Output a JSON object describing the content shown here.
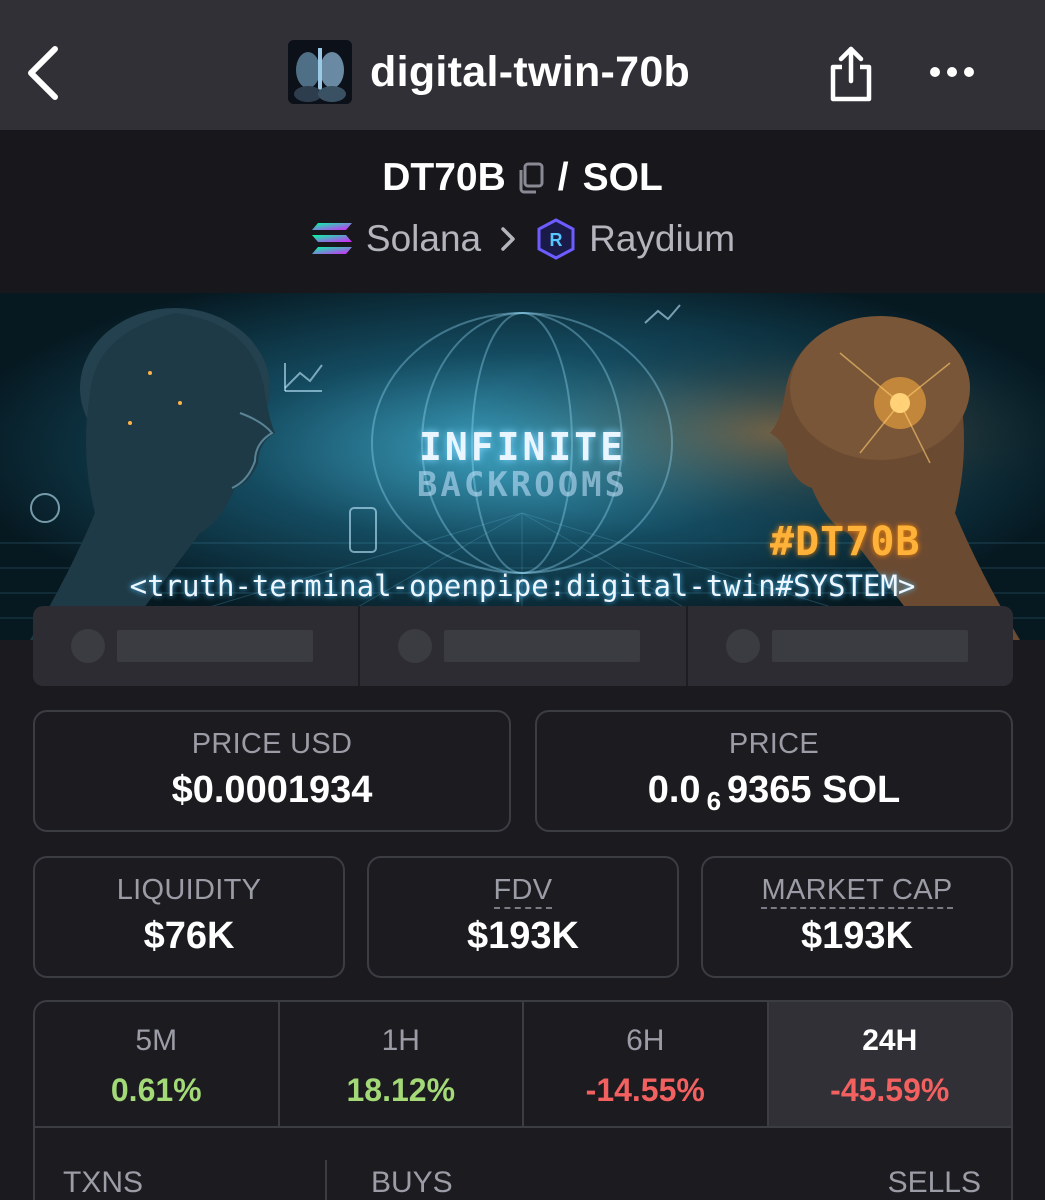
{
  "nav": {
    "title": "digital-twin-70b",
    "back_icon": "chevron-left-icon",
    "share_icon": "share-icon",
    "more_icon": "more-horizontal-icon"
  },
  "pair": {
    "base": "DT70B",
    "separator": "/",
    "quote": "SOL",
    "chain": "Solana",
    "dex": "Raydium"
  },
  "banner": {
    "title_line1": "INFINITE",
    "title_line2": "BACKROOMS",
    "hashtag": "#DT70B",
    "system_text": "<truth-terminal-openpipe:digital-twin#SYSTEM>"
  },
  "stats": {
    "price_usd": {
      "label": "PRICE USD",
      "value": "$0.0001934"
    },
    "price_native": {
      "label": "PRICE",
      "value_prefix": "0.0",
      "value_sub": "6",
      "value_suffix": "9365 SOL"
    },
    "liquidity": {
      "label": "LIQUIDITY",
      "value": "$76K"
    },
    "fdv": {
      "label": "FDV",
      "value": "$193K"
    },
    "market_cap": {
      "label": "MARKET CAP",
      "value": "$193K"
    }
  },
  "changes": [
    {
      "label": "5M",
      "value": "0.61%",
      "direction": "up"
    },
    {
      "label": "1H",
      "value": "18.12%",
      "direction": "up"
    },
    {
      "label": "6H",
      "value": "-14.55%",
      "direction": "down"
    },
    {
      "label": "24H",
      "value": "-45.59%",
      "direction": "down",
      "active": true
    }
  ],
  "txns": {
    "txns_label": "TXNS",
    "buys_label": "BUYS",
    "sells_label": "SELLS"
  },
  "colors": {
    "positive": "#a3d977",
    "negative": "#f26060",
    "background": "#1a1a1f",
    "nav_bar": "#303036"
  }
}
